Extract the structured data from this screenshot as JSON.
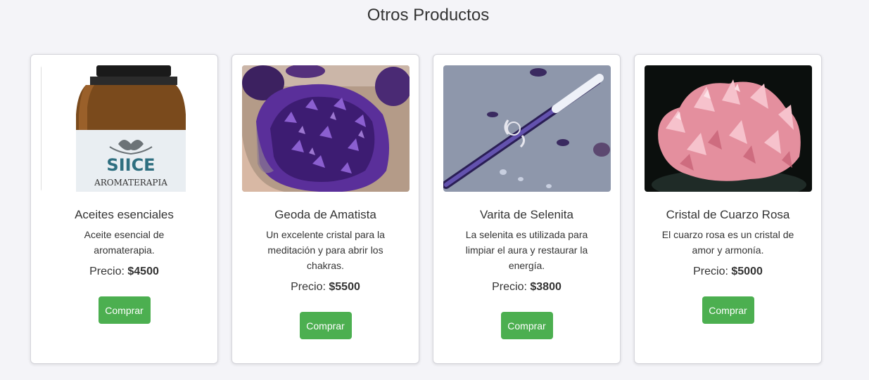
{
  "section": {
    "title": "Otros Productos"
  },
  "colors": {
    "background": "#f4f4f8",
    "card": "#ffffff",
    "button": "#4caf50",
    "text": "#333333"
  },
  "products": [
    {
      "image_icon": "essential-oil-bottle-photo",
      "image_label_brand": "SIICE",
      "image_label_line": "AROMATERAPIA",
      "title": "Aceites esenciales",
      "description": "Aceite esencial de aromaterapia.",
      "price_label": "Precio:",
      "price_value": "$4500",
      "button_label": "Comprar"
    },
    {
      "image_icon": "amethyst-geode-photo",
      "title": "Geoda de Amatista",
      "description": "Un excelente cristal para la meditación y para abrir los chakras.",
      "price_label": "Precio:",
      "price_value": "$5500",
      "button_label": "Comprar"
    },
    {
      "image_icon": "selenite-wand-photo",
      "title": "Varita de Selenita",
      "description": "La selenita es utilizada para limpiar el aura y restaurar la energía.",
      "price_label": "Precio:",
      "price_value": "$3800",
      "button_label": "Comprar"
    },
    {
      "image_icon": "rose-quartz-crystal-photo",
      "title": "Cristal de Cuarzo Rosa",
      "description": "El cuarzo rosa es un cristal de amor y armonía.",
      "price_label": "Precio:",
      "price_value": "$5000",
      "button_label": "Comprar"
    }
  ]
}
